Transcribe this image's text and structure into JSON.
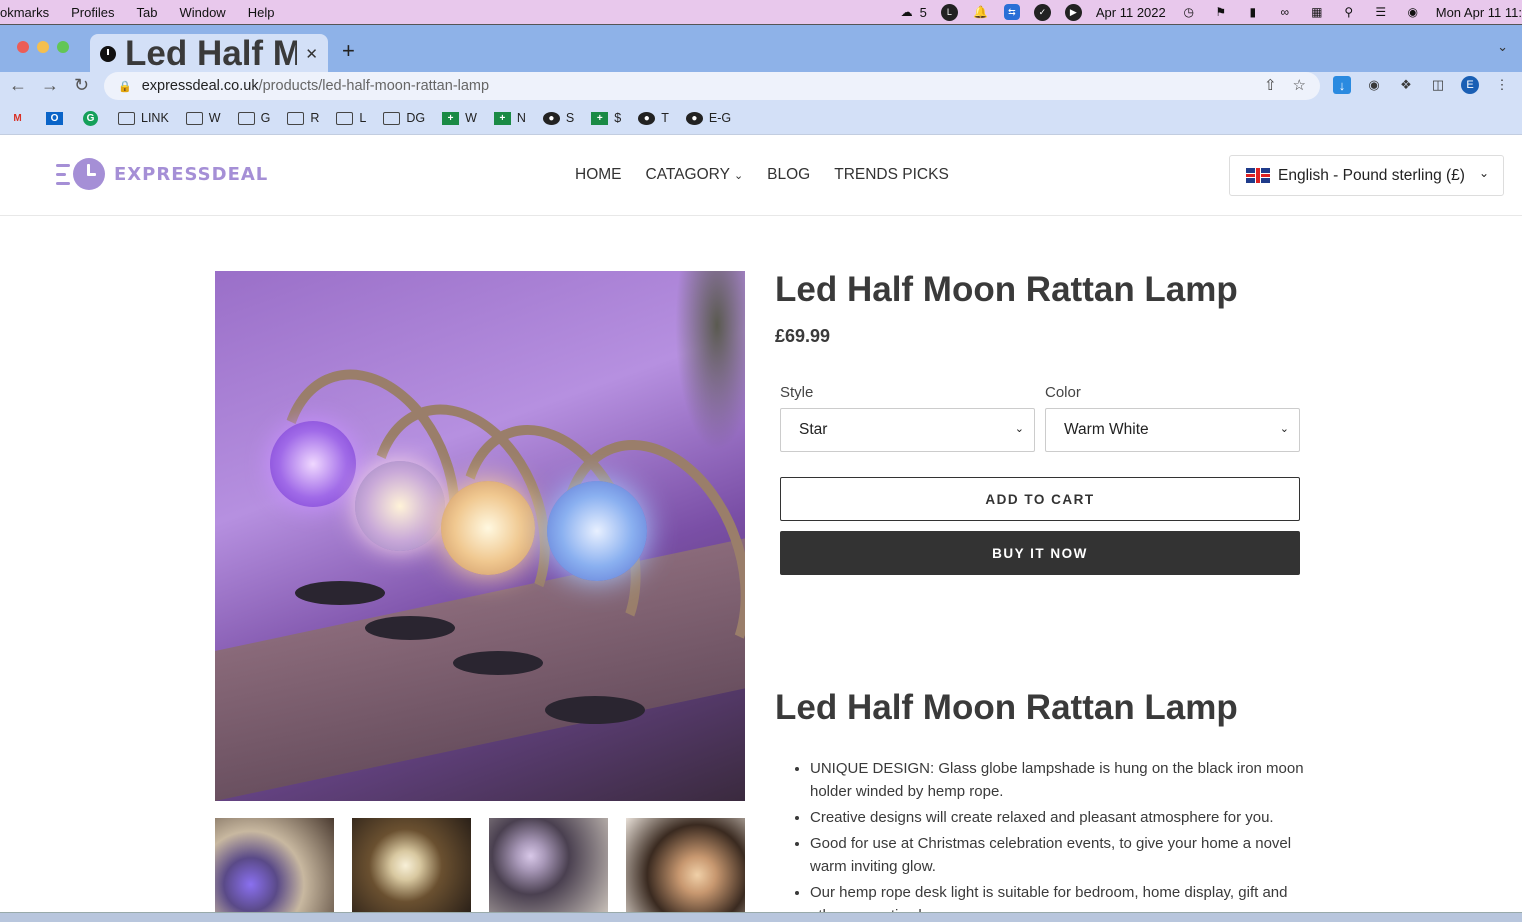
{
  "menubar": {
    "items": [
      "okmarks",
      "Profiles",
      "Tab",
      "Window",
      "Help"
    ],
    "wechat_count": "5",
    "date": "Apr 11 2022",
    "clock": "Mon Apr 11  11:"
  },
  "browser": {
    "tab_title": "Led Half Moon Rattan Lamp – E",
    "url_domain": "expressdeal.co.uk",
    "url_path": "/products/led-half-moon-rattan-lamp",
    "profile_initial": "E"
  },
  "bookmarks": [
    {
      "icon": "folder-icon",
      "label": "LINK"
    },
    {
      "icon": "folder-icon",
      "label": "W"
    },
    {
      "icon": "folder-icon",
      "label": "G"
    },
    {
      "icon": "folder-icon",
      "label": "R"
    },
    {
      "icon": "folder-icon",
      "label": "L"
    },
    {
      "icon": "folder-icon",
      "label": "DG"
    },
    {
      "icon": "sheets-icon",
      "label": "W"
    },
    {
      "icon": "sheets-icon",
      "label": "N"
    },
    {
      "icon": "globe-icon",
      "label": "S"
    },
    {
      "icon": "sheets-icon",
      "label": "$"
    },
    {
      "icon": "globe-icon",
      "label": "T"
    },
    {
      "icon": "globe-icon",
      "label": "E-G"
    }
  ],
  "site": {
    "logo_text": "EXPRESSDEAL",
    "nav": [
      "HOME",
      "CATAGORY",
      "BLOG",
      "TRENDS PICKS"
    ],
    "language": "English - Pound sterling (£)"
  },
  "product": {
    "title": "Led Half Moon Rattan Lamp",
    "price": "£69.99",
    "style_label": "Style",
    "style_value": "Star",
    "color_label": "Color",
    "color_value": "Warm White",
    "add_to_cart": "ADD TO CART",
    "buy_now": "BUY IT NOW",
    "desc_title": "Led Half Moon Rattan Lamp",
    "bullets": [
      "UNIQUE DESIGN: Glass globe lampshade is hung on the black iron moon holder winded by hemp rope.",
      "Creative designs will create relaxed and pleasant atmosphere for you.",
      "Good for use at Christmas celebration events, to give your home a novel warm inviting glow.",
      "Our hemp rope desk light is suitable for bedroom, home display, gift and other romantic places."
    ]
  },
  "colors": {
    "brand": "#a58fd6",
    "buy_button": "#333333",
    "tab_bar": "#8eb2e8",
    "menubar": "#e8c8ec"
  }
}
